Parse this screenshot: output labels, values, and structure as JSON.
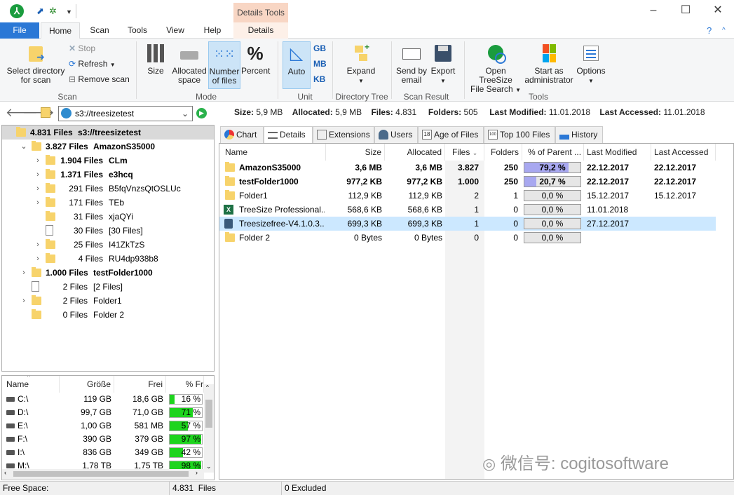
{
  "titlebar": {
    "context_tab": "Details Tools"
  },
  "tabs": [
    "File",
    "Home",
    "Scan",
    "Tools",
    "View",
    "Help"
  ],
  "context_sub": "Details",
  "ribbon": {
    "scan": {
      "select": "Select directory",
      "select2": "for scan",
      "stop": "Stop",
      "refresh": "Refresh",
      "remove": "Remove scan",
      "group": "Scan"
    },
    "mode": {
      "size": "Size",
      "alloc1": "Allocated",
      "alloc2": "space",
      "num1": "Number",
      "num2": "of files",
      "percent": "Percent",
      "group": "Mode"
    },
    "unit": {
      "auto": "Auto",
      "gb": "GB",
      "mb": "MB",
      "kb": "KB",
      "group": "Unit"
    },
    "dirtree": {
      "expand": "Expand",
      "group": "Directory Tree"
    },
    "result": {
      "send1": "Send by",
      "send2": "email",
      "export": "Export",
      "group": "Scan Result"
    },
    "tools": {
      "open1": "Open TreeSize",
      "open2": "File Search",
      "start1": "Start as",
      "start2": "administrator",
      "options": "Options",
      "group": "Tools"
    }
  },
  "address": "s3://treesizetest",
  "summary": {
    "size_label": "Size:",
    "size": "5,9 MB",
    "alloc_label": "Allocated:",
    "alloc": "5,9 MB",
    "files_label": "Files:",
    "files": "4.831",
    "folders_label": "Folders:",
    "folders": "505",
    "modified_label": "Last Modified:",
    "modified": "11.01.2018",
    "accessed_label": "Last Accessed:",
    "accessed": "11.01.2018"
  },
  "tree": [
    {
      "count": "4.831 Files",
      "name": "s3://treesizetest",
      "bold": true,
      "level": 0,
      "exp": "",
      "icon": "folder"
    },
    {
      "count": "3.827 Files",
      "name": "AmazonS35000",
      "bold": true,
      "level": 1,
      "exp": "⌄",
      "icon": "folder"
    },
    {
      "count": "1.904 Files",
      "name": "CLm",
      "bold": true,
      "level": 2,
      "exp": "›",
      "icon": "folder"
    },
    {
      "count": "1.371 Files",
      "name": "e3hcq",
      "bold": true,
      "level": 2,
      "exp": "›",
      "icon": "folder"
    },
    {
      "count": "291 Files",
      "name": "B5fqVnzsQtOSLUc",
      "bold": false,
      "level": 2,
      "exp": "›",
      "icon": "folder"
    },
    {
      "count": "171 Files",
      "name": "TEb",
      "bold": false,
      "level": 2,
      "exp": "›",
      "icon": "folder"
    },
    {
      "count": "31 Files",
      "name": "xjaQYi",
      "bold": false,
      "level": 2,
      "exp": "",
      "icon": "folder"
    },
    {
      "count": "30 Files",
      "name": "[30 Files]",
      "bold": false,
      "level": 2,
      "exp": "",
      "icon": "file"
    },
    {
      "count": "25 Files",
      "name": "I41ZkTzS",
      "bold": false,
      "level": 2,
      "exp": "›",
      "icon": "folder"
    },
    {
      "count": "4 Files",
      "name": "RU4dp938b8",
      "bold": false,
      "level": 2,
      "exp": "›",
      "icon": "folder"
    },
    {
      "count": "1.000 Files",
      "name": "testFolder1000",
      "bold": true,
      "level": 1,
      "exp": "›",
      "icon": "folder"
    },
    {
      "count": "2 Files",
      "name": "[2 Files]",
      "bold": false,
      "level": 1,
      "exp": "",
      "icon": "file"
    },
    {
      "count": "2 Files",
      "name": "Folder1",
      "bold": false,
      "level": 1,
      "exp": "›",
      "icon": "folder"
    },
    {
      "count": "0 Files",
      "name": "Folder 2",
      "bold": false,
      "level": 1,
      "exp": "",
      "icon": "folder"
    }
  ],
  "drives": {
    "headers": [
      "Name",
      "Größe",
      "Frei",
      "% Fr"
    ],
    "rows": [
      {
        "name": "C:\\",
        "size": "119 GB",
        "free": "18,6 GB",
        "pct": "16 %",
        "fill": 16
      },
      {
        "name": "D:\\",
        "size": "99,7 GB",
        "free": "71,0 GB",
        "pct": "71 %",
        "fill": 71
      },
      {
        "name": "E:\\",
        "size": "1,00 GB",
        "free": "581 MB",
        "pct": "57 %",
        "fill": 57
      },
      {
        "name": "F:\\",
        "size": "390 GB",
        "free": "379 GB",
        "pct": "97 %",
        "fill": 97
      },
      {
        "name": "I:\\",
        "size": "836 GB",
        "free": "349 GB",
        "pct": "42 %",
        "fill": 42
      },
      {
        "name": "M:\\",
        "size": "1,78 TB",
        "free": "1,75 TB",
        "pct": "98 %",
        "fill": 98
      }
    ]
  },
  "righttabs": [
    "Chart",
    "Details",
    "Extensions",
    "Users",
    "Age of Files",
    "Top 100 Files",
    "History"
  ],
  "details": {
    "headers": [
      "Name",
      "Size",
      "Allocated",
      "Files",
      "Folders",
      "% of Parent ...",
      "Last Modified",
      "Last Accessed"
    ],
    "rows": [
      {
        "name": "AmazonS35000",
        "size": "3,6 MB",
        "alloc": "3,6 MB",
        "files": "3.827",
        "folders": "250",
        "pct": "79,2 %",
        "pctval": 79.2,
        "mod": "22.12.2017",
        "acc": "22.12.2017",
        "bold": true,
        "icon": "folder",
        "selected": false
      },
      {
        "name": "testFolder1000",
        "size": "977,2 KB",
        "alloc": "977,2 KB",
        "files": "1.000",
        "folders": "250",
        "pct": "20,7 %",
        "pctval": 20.7,
        "mod": "22.12.2017",
        "acc": "22.12.2017",
        "bold": true,
        "icon": "folder",
        "selected": false
      },
      {
        "name": "Folder1",
        "size": "112,9 KB",
        "alloc": "112,9 KB",
        "files": "2",
        "folders": "1",
        "pct": "0,0 %",
        "pctval": 0,
        "mod": "15.12.2017",
        "acc": "15.12.2017",
        "bold": false,
        "icon": "folder",
        "selected": false
      },
      {
        "name": "TreeSize Professional...",
        "size": "568,6 KB",
        "alloc": "568,6 KB",
        "files": "1",
        "folders": "0",
        "pct": "0,0 %",
        "pctval": 0,
        "mod": "11.01.2018",
        "acc": "",
        "bold": false,
        "icon": "excel",
        "selected": false
      },
      {
        "name": "Treesizefree-V4.1.0.3...",
        "size": "699,3 KB",
        "alloc": "699,3 KB",
        "files": "1",
        "folders": "0",
        "pct": "0,0 %",
        "pctval": 0,
        "mod": "27.12.2017",
        "acc": "",
        "bold": false,
        "icon": "installer",
        "selected": true
      },
      {
        "name": "Folder 2",
        "size": "0 Bytes",
        "alloc": "0 Bytes",
        "files": "0",
        "folders": "0",
        "pct": "0,0 %",
        "pctval": 0,
        "mod": "",
        "acc": "",
        "bold": false,
        "icon": "folder",
        "selected": false
      }
    ]
  },
  "status": {
    "free": "Free Space:",
    "files": "4.831  Files",
    "excluded": "0 Excluded"
  },
  "watermark": "微信号: cogitosoftware",
  "colors": {
    "accent": "#2b78d6",
    "selection": "#cce8ff",
    "drive_fill": "#1ed41e",
    "pct_fill": "#a8a8f0"
  }
}
